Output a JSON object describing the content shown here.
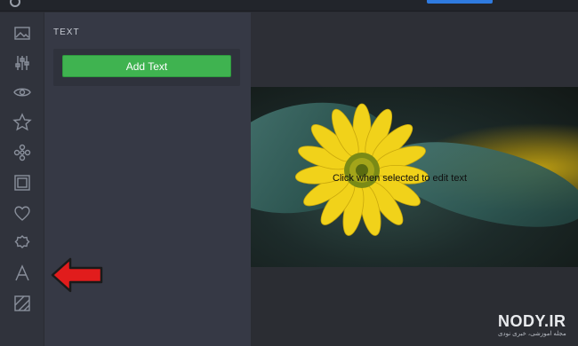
{
  "topbar": {},
  "sidebar": {
    "tools": [
      {
        "icon": "image-icon"
      },
      {
        "icon": "sliders-icon"
      },
      {
        "icon": "eye-icon"
      },
      {
        "icon": "star-icon"
      },
      {
        "icon": "flower-icon"
      },
      {
        "icon": "frame-icon"
      },
      {
        "icon": "heart-icon"
      },
      {
        "icon": "badge-icon"
      },
      {
        "icon": "text-tool-icon"
      },
      {
        "icon": "texture-icon"
      }
    ]
  },
  "panel": {
    "title": "TEXT",
    "add_text_label": "Add Text"
  },
  "canvas": {
    "edit_hint": "Click when selected to edit text"
  },
  "annotation": {
    "arrow_color": "#e11c1c"
  },
  "watermark": {
    "brand": "NODY.IR",
    "subtitle": "مجله اموزشی، خبری نودی"
  },
  "colors": {
    "accent_green": "#3fb350",
    "accent_blue": "#2f7be0",
    "panel_bg": "#363945",
    "iconbar_bg": "#30333c"
  }
}
